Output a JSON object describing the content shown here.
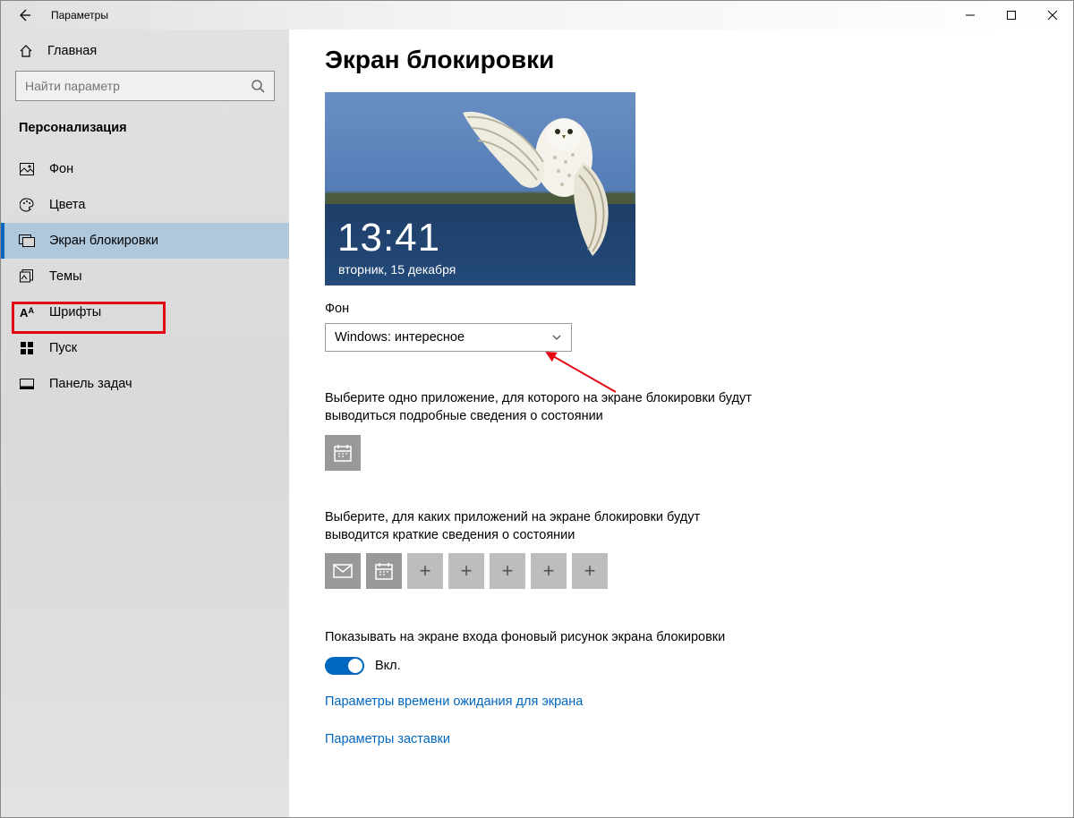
{
  "window": {
    "title": "Параметры"
  },
  "sidebar": {
    "home_label": "Главная",
    "search_placeholder": "Найти параметр",
    "section_title": "Персонализация",
    "items": [
      {
        "label": "Фон",
        "icon": "picture-icon"
      },
      {
        "label": "Цвета",
        "icon": "palette-icon"
      },
      {
        "label": "Экран блокировки",
        "icon": "lockscreen-icon",
        "active": true
      },
      {
        "label": "Темы",
        "icon": "themes-icon"
      },
      {
        "label": "Шрифты",
        "icon": "fonts-icon"
      },
      {
        "label": "Пуск",
        "icon": "start-icon"
      },
      {
        "label": "Панель задач",
        "icon": "taskbar-icon"
      }
    ]
  },
  "main": {
    "page_title": "Экран блокировки",
    "preview": {
      "time": "13:41",
      "date": "вторник, 15 декабря"
    },
    "background_label": "Фон",
    "background_value": "Windows: интересное",
    "detailed_status_text": "Выберите одно приложение, для которого на экране блокировки будут выводиться подробные сведения о состоянии",
    "quick_status_text": "Выберите, для каких приложений на экране блокировки будут выводится краткие сведения о состоянии",
    "toggle_text": "Показывать на экране входа фоновый рисунок экрана блокировки",
    "toggle_state_label": "Вкл.",
    "link_timeout": "Параметры времени ожидания для экрана",
    "link_screensaver": "Параметры заставки"
  }
}
